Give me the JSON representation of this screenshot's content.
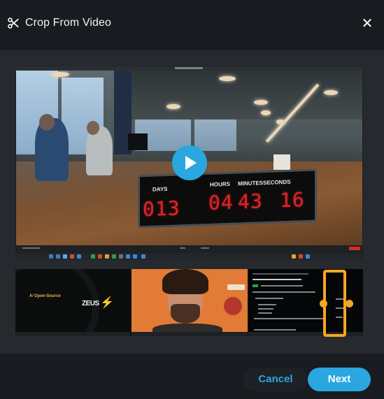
{
  "dialog": {
    "title": "Crop From Video",
    "title_icon": "scissors-icon",
    "close_icon": "close-icon",
    "close_glyph": "✕"
  },
  "preview": {
    "play_icon": "play-icon",
    "clock": {
      "labels": [
        "DAYS",
        "HOURS",
        "MINUTES",
        "SECONDS"
      ],
      "days": "013",
      "hours": "04",
      "minutes": "43",
      "seconds": "16"
    }
  },
  "filmstrip": {
    "frames": [
      {
        "name": "intro-frame",
        "caption": "A⁄ Open-Source",
        "logo": "ZEUS",
        "bolt": "⚡"
      },
      {
        "name": "webcam-frame"
      },
      {
        "name": "code-frame"
      }
    ],
    "crop_selection": {
      "start_fraction": 0.889,
      "end_fraction": 0.956
    }
  },
  "footer": {
    "cancel_label": "Cancel",
    "next_label": "Next"
  },
  "colors": {
    "accent": "#2aa6e0",
    "crop_handle": "#f5a623",
    "background": "#181b1f",
    "panel": "#262a2e"
  }
}
